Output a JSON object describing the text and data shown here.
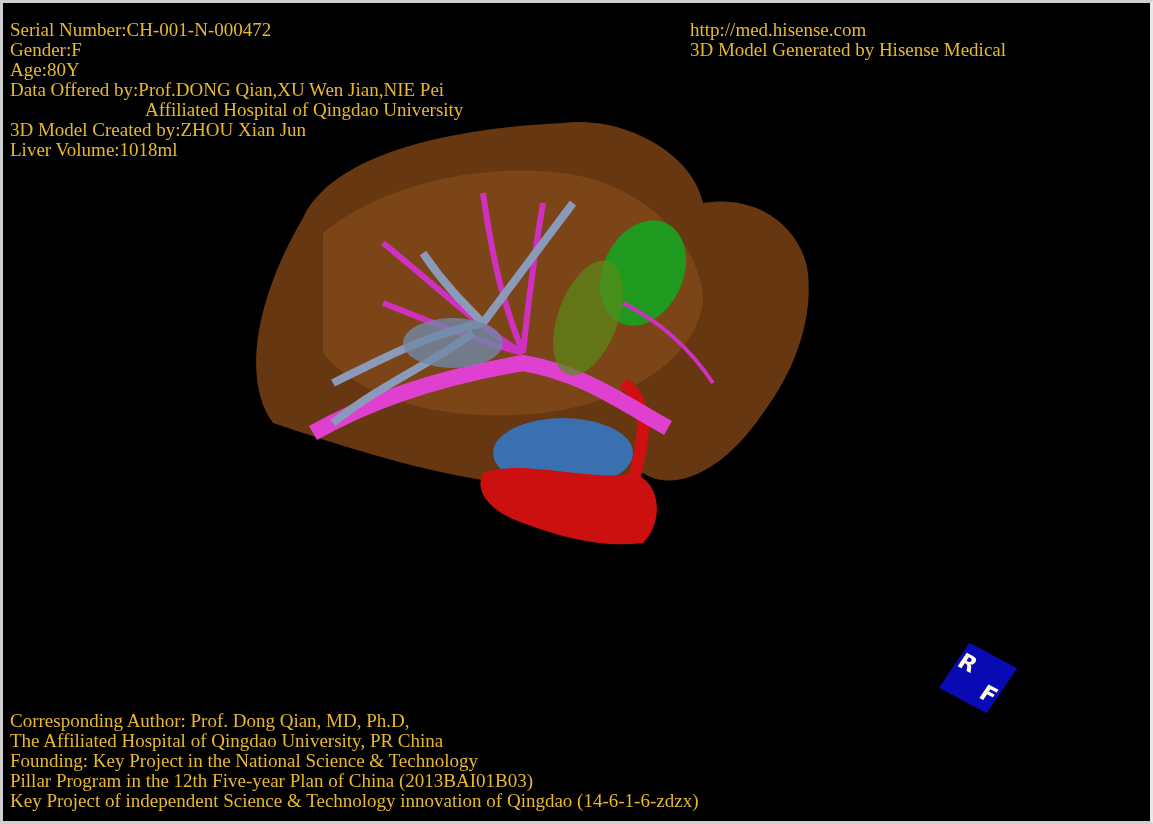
{
  "info_left": [
    {
      "kind": "line",
      "text": "Serial Number:CH-001-N-000472"
    },
    {
      "kind": "line",
      "text": "Gender:F"
    },
    {
      "kind": "line",
      "text": "Age:80Y"
    },
    {
      "kind": "line",
      "text": "Data Offered by:Prof.DONG Qian,XU Wen Jian,NIE Pei"
    },
    {
      "kind": "continuation",
      "text": "Affiliated Hospital of Qingdao University"
    },
    {
      "kind": "line",
      "text": "3D Model Created by:ZHOU Xian Jun"
    },
    {
      "kind": "line",
      "text": "Liver Volume:1018ml"
    }
  ],
  "info_right": [
    "http://med.hisense.com",
    "3D Model Generated by Hisense Medical"
  ],
  "orientation_cube": {
    "labels": [
      "R",
      "F"
    ]
  },
  "credits": [
    "Corresponding Author: Prof. Dong Qian, MD, Ph.D,",
    "The Affiliated Hospital of Qingdao University, PR China",
    "Founding: Key Project in the National Science & Technology",
    "Pillar Program in the 12th Five-year Plan of China (2013BAI01B03)",
    "Key Project of independent Science & Technology innovation of Qingdao (14-6-1-6-zdzx)"
  ]
}
